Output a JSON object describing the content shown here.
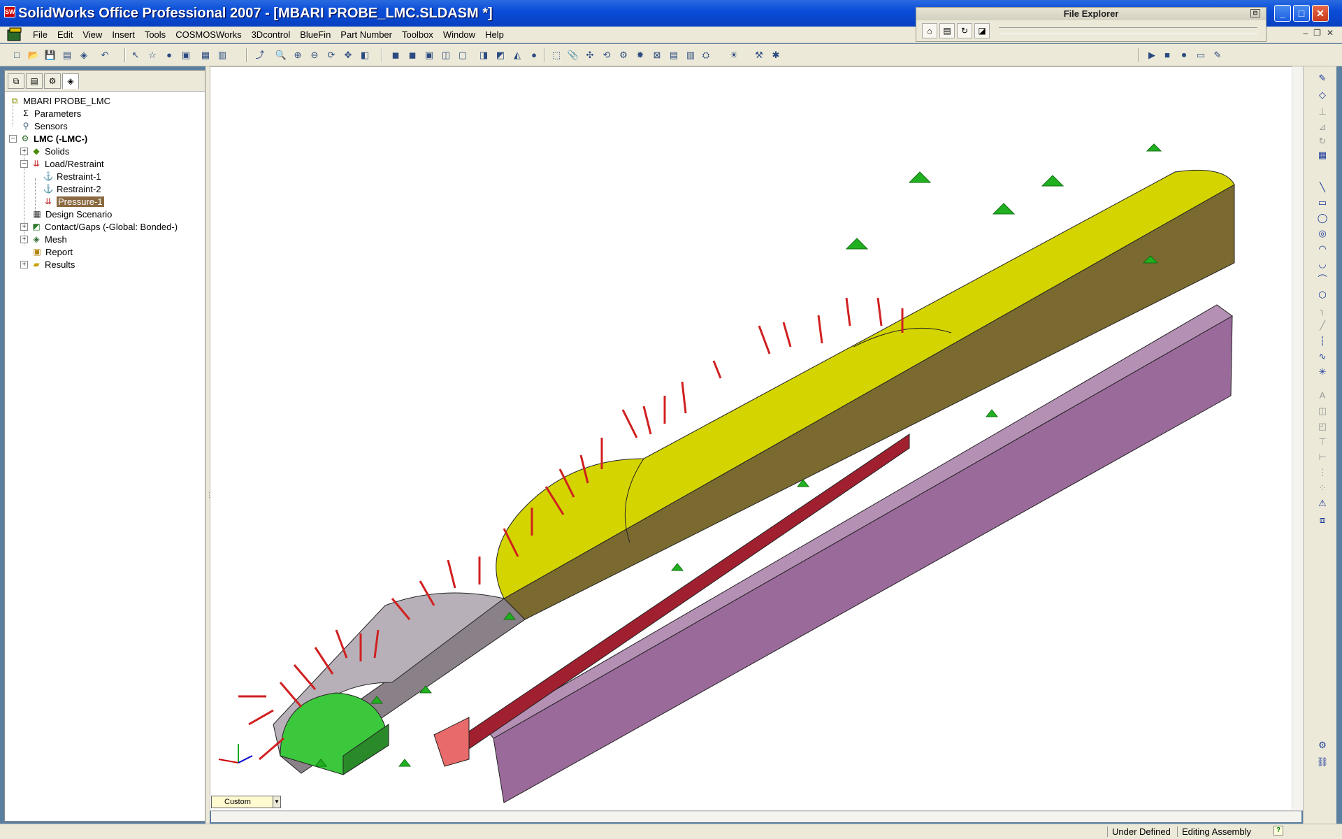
{
  "window": {
    "title": "SolidWorks Office Professional 2007 - [MBARI PROBE_LMC.SLDASM *]",
    "app_icon": "SW"
  },
  "menu": {
    "items": [
      "File",
      "Edit",
      "View",
      "Insert",
      "Tools",
      "COSMOSWorks",
      "3Dcontrol",
      "BlueFin",
      "Part Number",
      "Toolbox",
      "Window",
      "Help"
    ]
  },
  "file_explorer": {
    "title": "File Explorer"
  },
  "tree": {
    "root": "MBARI PROBE_LMC",
    "parameters": "Parameters",
    "sensors": "Sensors",
    "study": "LMC (-LMC-)",
    "solids": "Solids",
    "load_restraint": "Load/Restraint",
    "restraint1": "Restraint-1",
    "restraint2": "Restraint-2",
    "pressure1": "Pressure-1",
    "design_scenario": "Design Scenario",
    "contact": "Contact/Gaps (-Global: Bonded-)",
    "mesh": "Mesh",
    "report": "Report",
    "results": "Results"
  },
  "viewport": {
    "view_orientation": "Custom"
  },
  "status": {
    "state": "Under Defined",
    "mode": "Editing Assembly",
    "help_icon": "?"
  },
  "colors": {
    "titlebar": "#0a4dd8",
    "yellow_body": "#d4d400",
    "olive_face": "#7a6a30",
    "purple_base": "#9a6a9a",
    "gray_body": "#8a8088",
    "red_channel": "#9a2030",
    "green_end": "#3cc83c",
    "pressure_arrows": "#d02020",
    "restraint_arrows": "#20b020"
  }
}
